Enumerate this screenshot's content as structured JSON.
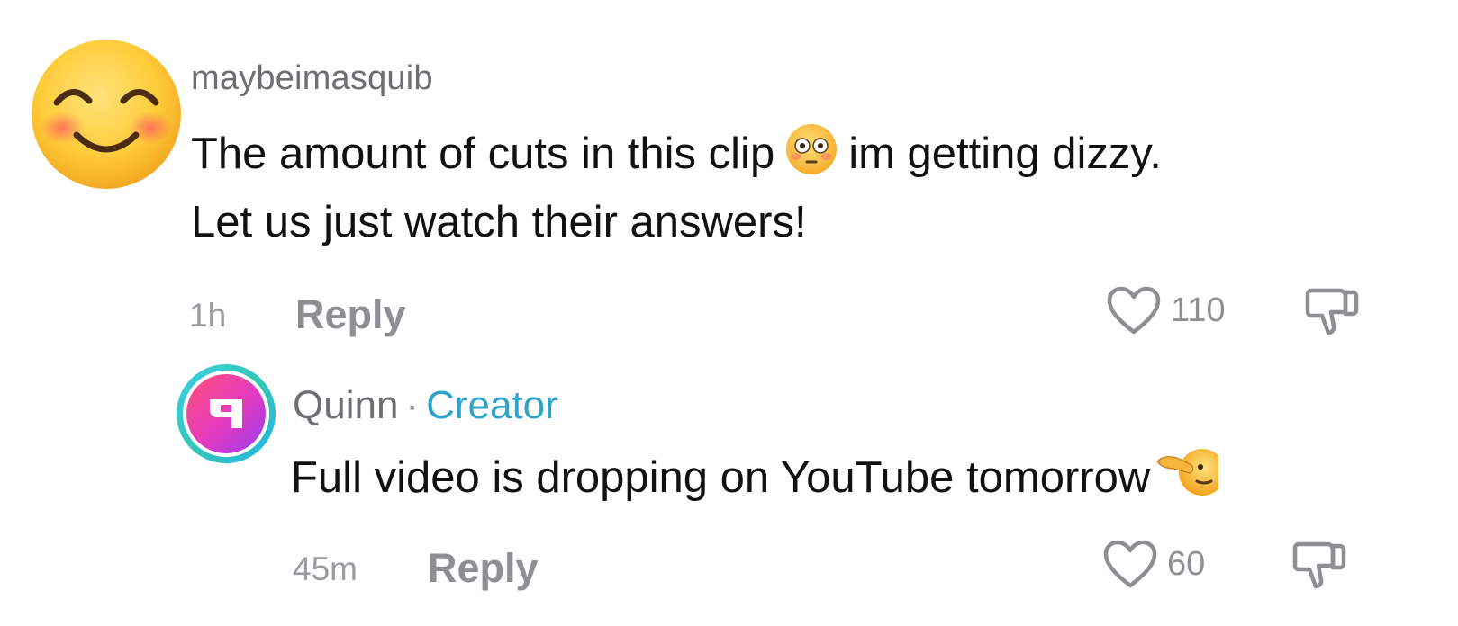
{
  "comments": [
    {
      "avatar_icon": "smiling-face-with-blush-emoji",
      "username": "maybeimasquib",
      "text_part1": "The amount of cuts in this clip",
      "inline_emoji": "flushed-face-emoji",
      "text_part2": "im getting dizzy.",
      "text_line2": "Let us just watch their answers!",
      "timestamp": "1h",
      "reply_label": "Reply",
      "like_count": "110",
      "liked": false
    }
  ],
  "reply": {
    "avatar_icon": "quinn-logo",
    "username": "Quinn",
    "separator": "·",
    "badge": "Creator",
    "text": "Full video is dropping on YouTube tomorrow",
    "trailing_emoji": "face-pointing-left-emoji",
    "timestamp": "45m",
    "reply_label": "Reply",
    "like_count": "60",
    "liked": false
  },
  "colors": {
    "creator_badge": "#2ea3cc",
    "muted_text": "#8e8e93",
    "primary_text": "#111111"
  }
}
